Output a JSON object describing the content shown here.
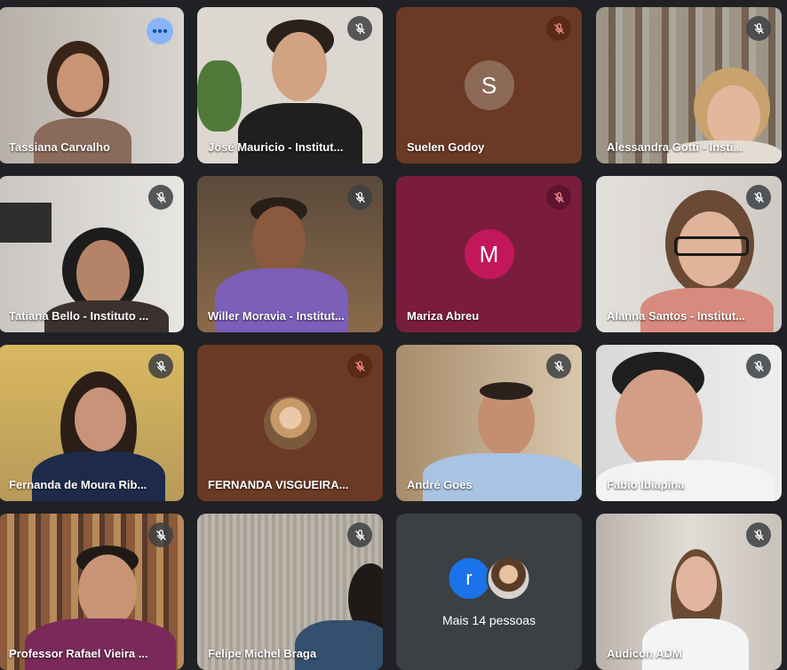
{
  "tiles": [
    {
      "name": "Tassiana Carvalho",
      "bg": "#c8c2bb",
      "muted": false,
      "more": true
    },
    {
      "name": "José Mauricio - Institut...",
      "bg": "#d9d4cd",
      "muted": true
    },
    {
      "name": "Suelen Godoy",
      "bg": "#6b3a24",
      "muted": true,
      "initial": "S",
      "avatarColor": "#8d6a58"
    },
    {
      "name": "Alessandra Gotti - Insti...",
      "bg": "#cfc9bf",
      "muted": true
    },
    {
      "name": "Tatiana Bello - Instituto ...",
      "bg": "#d7d3cf",
      "muted": true
    },
    {
      "name": "Willer Moravia - Institut...",
      "bg": "#6b5a48",
      "muted": true
    },
    {
      "name": "Mariza Abreu",
      "bg": "#7a1d3c",
      "muted": true,
      "initial": "M",
      "avatarColor": "#c2185b"
    },
    {
      "name": "Alanna Santos - Institut...",
      "bg": "#dcd8d4",
      "muted": true
    },
    {
      "name": "Fernanda de Moura Rib...",
      "bg": "#c9a85a",
      "muted": true
    },
    {
      "name": "FERNANDA VISGUEIRA...",
      "bg": "#6b3a24",
      "muted": true,
      "photoAvatar": true
    },
    {
      "name": "André Goes",
      "bg": "#bfa98c",
      "muted": true
    },
    {
      "name": "Fabio Ibiapina",
      "bg": "#e6e6e6",
      "muted": true
    },
    {
      "name": "Professor Rafael Vieira ...",
      "bg": "#8a6a4a",
      "muted": true
    },
    {
      "name": "Felipe Michel Braga",
      "bg": "#b9b2a8",
      "muted": true
    },
    {
      "name": "",
      "bg": "#3c4043",
      "muted": false,
      "morePeople": true
    },
    {
      "name": "Audicon ADM",
      "bg": "#cfc9c2",
      "muted": true
    }
  ],
  "more_people": {
    "initial": "r",
    "label": "Mais 14 pessoas"
  }
}
